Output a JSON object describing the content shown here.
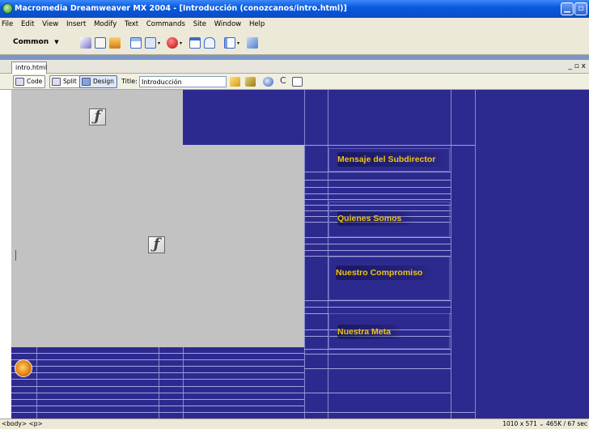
{
  "window": {
    "title": "Macromedia Dreamweaver MX 2004 - [Introducción (conozcanos/intro.html)]",
    "minimize": "▁",
    "maximize": "▫"
  },
  "menu": [
    "File",
    "Edit",
    "View",
    "Insert",
    "Modify",
    "Text",
    "Commands",
    "Site",
    "Window",
    "Help"
  ],
  "insert_bar": {
    "category": "Common",
    "dropdown": "▼"
  },
  "document": {
    "tab": "intro.html",
    "window_controls": "_ ▫ x",
    "views": [
      "Code",
      "Split",
      "Design"
    ],
    "active_view": "Design",
    "title_label": "Title:",
    "title_value": "Introducción",
    "refresh": "C"
  },
  "page": {
    "background": "#2d2a8f",
    "accent": "#f0c415",
    "nav": [
      "Mensaje del Subdirector",
      "Quienes Somos",
      "Nuestro Compromiso",
      "Nuestra Meta"
    ]
  },
  "status": {
    "tag_selector": "<body> <p>",
    "dimensions": "1010 x 571 ⌄ 465K / 67 sec"
  }
}
